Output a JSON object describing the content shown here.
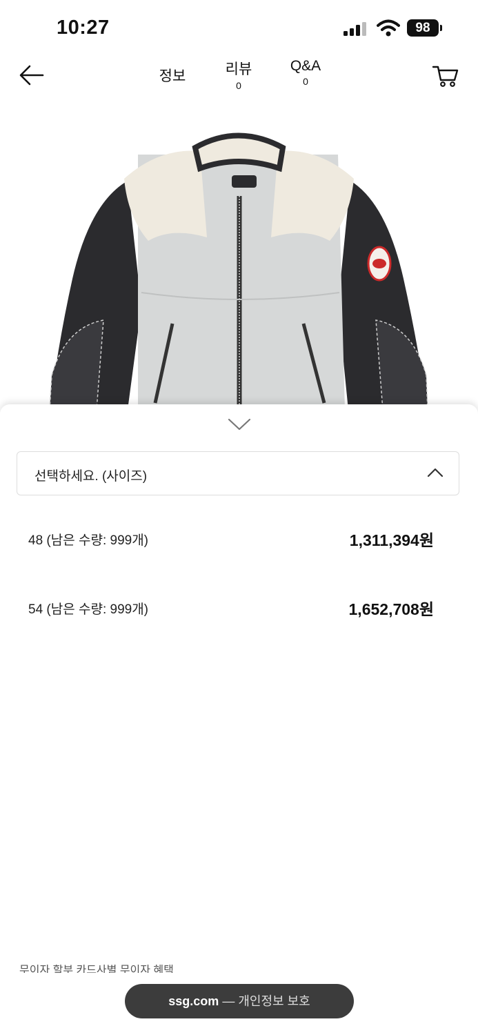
{
  "status_bar": {
    "time": "10:27",
    "battery": "98"
  },
  "nav": {
    "tabs": [
      {
        "label": "정보"
      },
      {
        "label": "리뷰",
        "count": "0"
      },
      {
        "label": "Q&A",
        "count": "0"
      }
    ]
  },
  "option_sheet": {
    "select_placeholder": "선택하세요. (사이즈)",
    "options": [
      {
        "label": "48 (남은 수량: 999개)",
        "price": "1,311,394원"
      },
      {
        "label": "54 (남은 수량: 999개)",
        "price": "1,652,708원"
      }
    ]
  },
  "footer": {
    "partial_text": "무이자 할부     카드사별 무이자 혜택"
  },
  "toast": {
    "domain": "ssg.com",
    "text": "— 개인정보 보호"
  },
  "colors": {
    "toast_bg": "#3c3c3c",
    "sheet_border": "#dddddd"
  }
}
